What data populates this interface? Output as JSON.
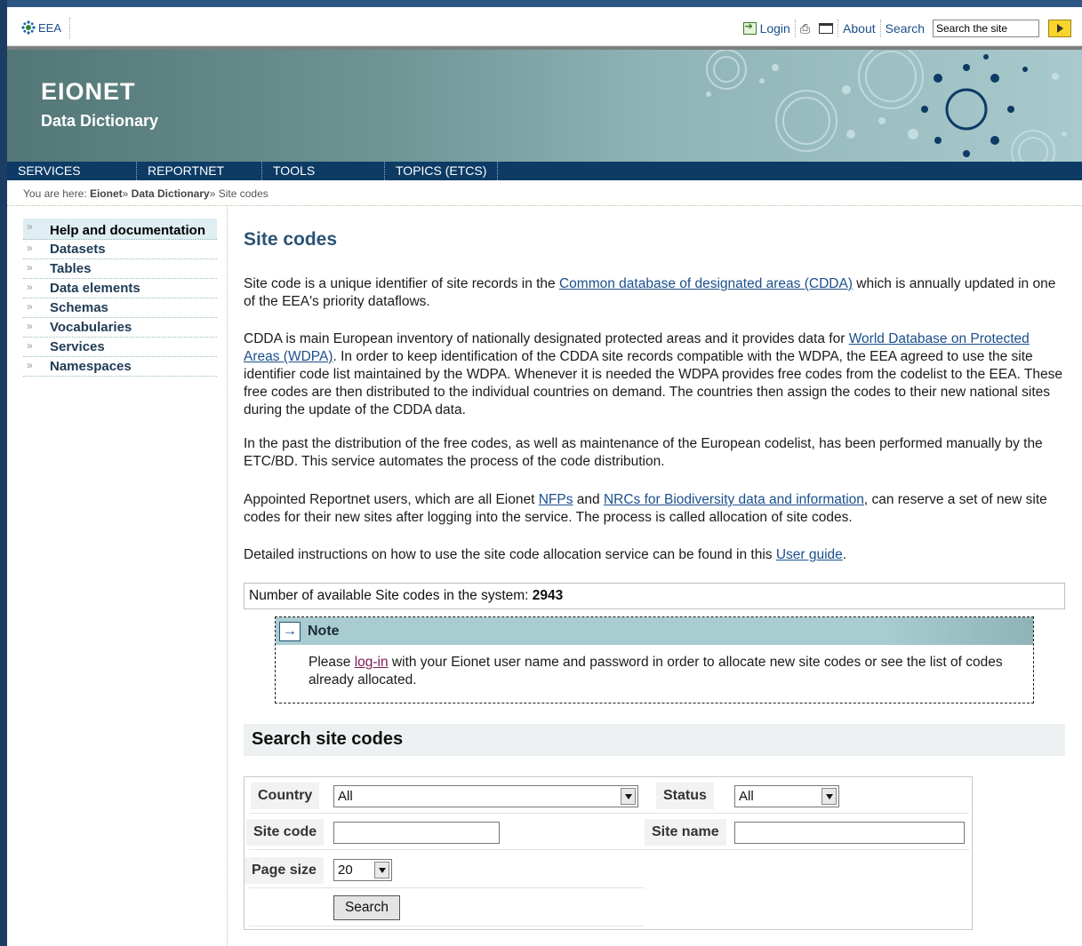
{
  "toolbar": {
    "logo_text": "EEA",
    "login_label": "Login",
    "about_label": "About",
    "search_label": "Search",
    "search_value": "Search the site"
  },
  "banner": {
    "title": "EIONET",
    "subtitle": "Data Dictionary"
  },
  "nav": {
    "items": [
      "SERVICES",
      "REPORTNET",
      "TOOLS",
      "TOPICS (ETCS)"
    ]
  },
  "breadcrumb": {
    "prefix": "You are here:",
    "items": [
      "Eionet",
      "Data Dictionary",
      "Site codes"
    ],
    "separator": "»"
  },
  "sidebar": {
    "items": [
      "Help and documentation",
      "Datasets",
      "Tables",
      "Data elements",
      "Schemas",
      "Vocabularies",
      "Services",
      "Namespaces"
    ],
    "arrow": "»"
  },
  "main": {
    "title": "Site codes",
    "p1_before": "Site code is a unique identifier of site records in the ",
    "p1_link": "Common database of designated areas (CDDA)",
    "p1_after": " which is annually updated in one of the EEA's priority dataflows.",
    "p2_before": "CDDA is main European inventory of nationally designated protected areas and it provides data for ",
    "p2_link": "World Database on Protected Areas (WDPA)",
    "p2_after": ". In order to keep identification of the CDDA site records compatible with the WDPA, the EEA agreed to use the site identifier code list maintained by the WDPA. Whenever it is needed the WDPA provides free codes from the codelist to the EEA. These free codes are then distributed to the individual countries on demand. The countries then assign the codes to their new national sites during the update of the CDDA data.",
    "p3": "In the past the distribution of the free codes, as well as maintenance of the European codelist, has been performed manually by the ETC/BD. This service automates the process of the code distribution.",
    "p4_before": "Appointed Reportnet users, which are all Eionet ",
    "p4_link1": "NFPs",
    "p4_mid": " and ",
    "p4_link2": "NRCs for Biodiversity data and information",
    "p4_after": ", can reserve a set of new site codes for their new sites after logging into the service. The process is called allocation of site codes.",
    "p5_before": "Detailed instructions on how to use the site code allocation service can be found in this ",
    "p5_link": "User guide",
    "p5_after": ".",
    "count_label": "Number of available Site codes in the system:",
    "count_value": "2943",
    "note": {
      "title": "Note",
      "text_before": "Please ",
      "link": "log-in",
      "text_after": " with your Eionet user name and password in order to allocate new site codes or see the list of codes already allocated."
    }
  },
  "search_form": {
    "heading": "Search site codes",
    "country_label": "Country",
    "country_value": "All",
    "status_label": "Status",
    "status_value": "All",
    "site_code_label": "Site code",
    "site_code_value": "",
    "site_name_label": "Site name",
    "site_name_value": "",
    "page_size_label": "Page size",
    "page_size_value": "20",
    "submit_label": "Search"
  }
}
